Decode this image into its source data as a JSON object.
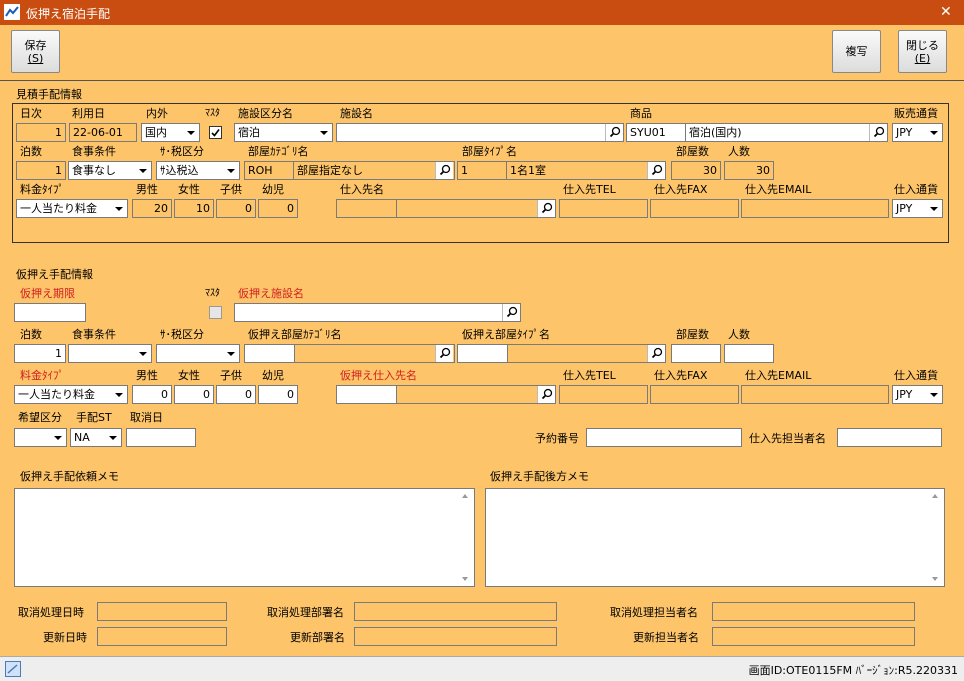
{
  "window": {
    "title": "仮押え宿泊手配",
    "close": "✕"
  },
  "toolbar": {
    "save_label": "保存",
    "save_key": "(S)",
    "copy_label": "複写",
    "close_label": "閉じる",
    "close_key": "(E)"
  },
  "est": {
    "section_title": "見積手配情報",
    "labels": {
      "day_no": "日次",
      "use_date": "利用日",
      "domestic": "内外",
      "master": "ﾏｽﾀ",
      "facility_type": "施設区分名",
      "facility_name": "施設名",
      "product": "商品",
      "sales_currency": "販売通貨",
      "nights": "泊数",
      "meal": "食事条件",
      "tax": "ｻ･税区分",
      "room_category": "部屋ｶﾃｺﾞﾘ名",
      "room_type": "部屋ﾀｲﾌﾟ名",
      "rooms": "部屋数",
      "persons": "人数",
      "rate_type": "料金ﾀｲﾌﾟ",
      "male": "男性",
      "female": "女性",
      "child": "子供",
      "infant": "幼児",
      "supplier": "仕入先名",
      "supplier_tel": "仕入先TEL",
      "supplier_fax": "仕入先FAX",
      "supplier_email": "仕入先EMAIL",
      "purchase_currency": "仕入通貨"
    },
    "values": {
      "day_no": "1",
      "use_date": "22-06-01",
      "domestic": "国内",
      "facility_type": "宿泊",
      "facility_name": "",
      "product_code": "SYU01",
      "product_name": "宿泊(国内)",
      "sales_currency": "JPY",
      "nights": "1",
      "meal": "食事なし",
      "tax": "ｻ込税込",
      "room_category_code": "ROH",
      "room_category_name": "部屋指定なし",
      "room_type_code": "1",
      "room_type_name": "1名1室",
      "rooms": "30",
      "persons": "30",
      "rate_type": "一人当たり料金",
      "male": "20",
      "female": "10",
      "child": "0",
      "infant": "0",
      "supplier_code": "",
      "supplier_name": "",
      "supplier_tel": "",
      "supplier_fax": "",
      "supplier_email": "",
      "purchase_currency": "JPY"
    }
  },
  "hold": {
    "section_title": "仮押え手配情報",
    "labels": {
      "deadline": "仮押え期限",
      "master": "ﾏｽﾀ",
      "facility_name": "仮押え施設名",
      "nights": "泊数",
      "meal": "食事条件",
      "tax": "ｻ･税区分",
      "room_category": "仮押え部屋ｶﾃｺﾞﾘ名",
      "room_type": "仮押え部屋ﾀｲﾌﾟ名",
      "rooms": "部屋数",
      "persons": "人数",
      "rate_type": "料金ﾀｲﾌﾟ",
      "male": "男性",
      "female": "女性",
      "child": "子供",
      "infant": "幼児",
      "supplier": "仮押え仕入先名",
      "supplier_tel": "仕入先TEL",
      "supplier_fax": "仕入先FAX",
      "supplier_email": "仕入先EMAIL",
      "purchase_currency": "仕入通貨",
      "wish": "希望区分",
      "arrange_st": "手配ST",
      "cancel_date": "取消日",
      "booking_no": "予約番号",
      "supplier_staff": "仕入先担当者名"
    },
    "values": {
      "deadline": "",
      "facility_name": "",
      "nights": "1",
      "meal": "",
      "tax": "",
      "room_category_code": "",
      "room_category_name": "",
      "room_type_code": "",
      "room_type_name": "",
      "rooms": "",
      "persons": "",
      "rate_type": "一人当たり料金",
      "male": "0",
      "female": "0",
      "child": "0",
      "infant": "0",
      "supplier_code": "",
      "supplier_name": "",
      "supplier_tel": "",
      "supplier_fax": "",
      "supplier_email": "",
      "purchase_currency": "JPY",
      "wish": "",
      "arrange_st": "NA",
      "cancel_date": "",
      "booking_no": "",
      "supplier_staff": ""
    }
  },
  "memo": {
    "request_label": "仮押え手配依頼メモ",
    "back_label": "仮押え手配後方メモ",
    "request": "",
    "back": ""
  },
  "audit": {
    "labels": {
      "cancel_datetime": "取消処理日時",
      "cancel_dept": "取消処理部署名",
      "cancel_staff": "取消処理担当者名",
      "update_datetime": "更新日時",
      "update_dept": "更新部署名",
      "update_staff": "更新担当者名"
    },
    "values": {
      "cancel_datetime": "",
      "cancel_dept": "",
      "cancel_staff": "",
      "update_datetime": "",
      "update_dept": "",
      "update_staff": ""
    }
  },
  "status": {
    "screen_id": "画面ID:OTE0115FM ﾊﾞｰｼﾞｮﾝ:R5.220331"
  },
  "colors": {
    "titlebar": "#C94D11",
    "background": "#FDC46A",
    "required_label": "#D02020"
  }
}
